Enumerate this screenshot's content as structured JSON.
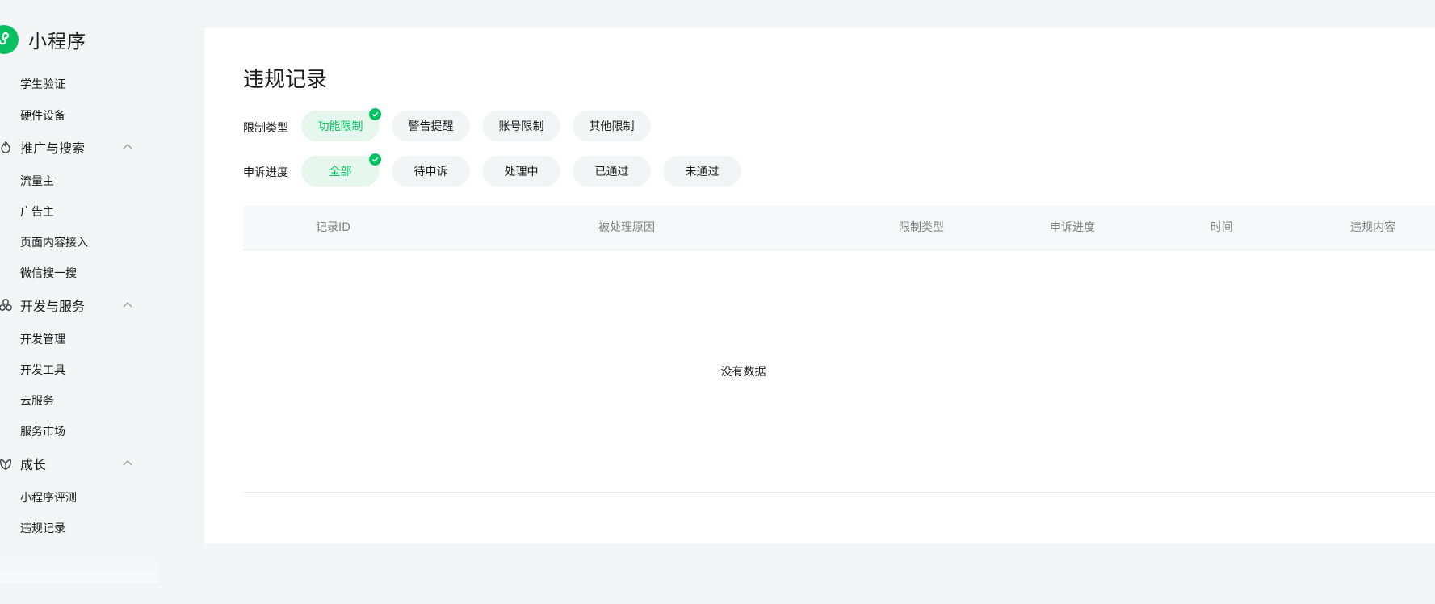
{
  "brand": {
    "name": "小程序",
    "logo_icon": "mini-program-logo-icon"
  },
  "sidebar": {
    "items_top": [
      {
        "label": "学生验证"
      },
      {
        "label": "硬件设备"
      }
    ],
    "groups": [
      {
        "label": "推广与搜索",
        "icon": "promotion-icon",
        "expanded": true,
        "items": [
          {
            "label": "流量主"
          },
          {
            "label": "广告主"
          },
          {
            "label": "页面内容接入"
          },
          {
            "label": "微信搜一搜"
          }
        ]
      },
      {
        "label": "开发与服务",
        "icon": "dev-service-icon",
        "expanded": true,
        "items": [
          {
            "label": "开发管理"
          },
          {
            "label": "开发工具"
          },
          {
            "label": "云服务"
          },
          {
            "label": "服务市场"
          }
        ]
      },
      {
        "label": "成长",
        "icon": "growth-icon",
        "expanded": true,
        "items": [
          {
            "label": "小程序评测"
          },
          {
            "label": "违规记录"
          }
        ]
      }
    ]
  },
  "main": {
    "title": "违规记录",
    "filters": {
      "restriction_type": {
        "label": "限制类型",
        "options": [
          "功能限制",
          "警告提醒",
          "账号限制",
          "其他限制"
        ],
        "selected": "功能限制"
      },
      "appeal_progress": {
        "label": "申诉进度",
        "options": [
          "全部",
          "待申诉",
          "处理中",
          "已通过",
          "未通过"
        ],
        "selected": "全部"
      }
    },
    "table": {
      "columns": [
        "记录ID",
        "被处理原因",
        "限制类型",
        "申诉进度",
        "时间",
        "违规内容"
      ],
      "rows": [],
      "empty_text": "没有数据"
    }
  },
  "colors": {
    "accent": "#07c160",
    "page_bg": "#f4f5f7",
    "chip_bg": "#f3f4f6",
    "chip_active_bg": "#e6f8ee",
    "header_text": "#7f7f7f"
  }
}
